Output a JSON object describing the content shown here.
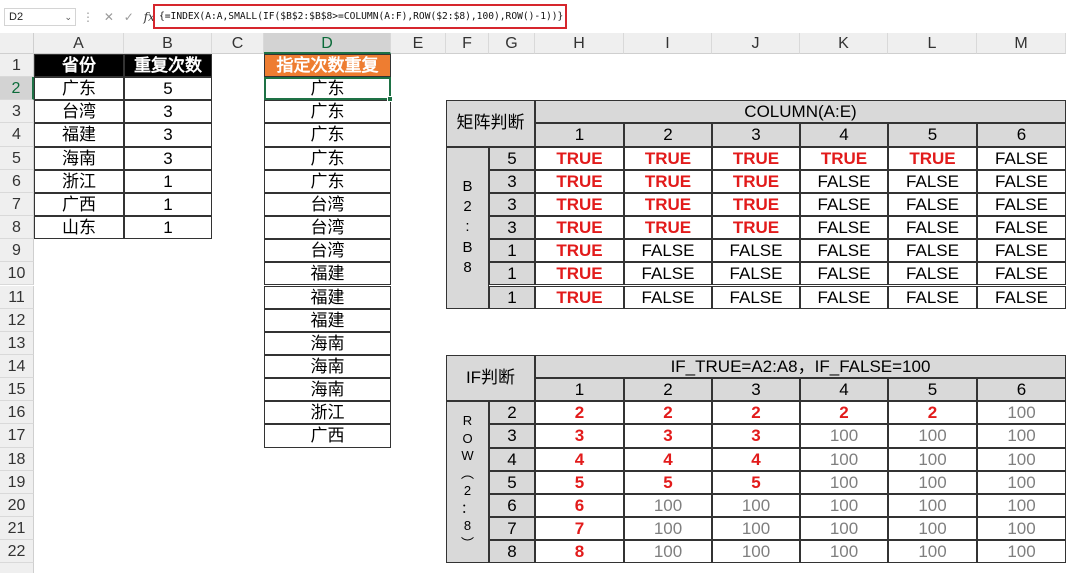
{
  "formula_bar": {
    "name_box": "D2",
    "name_box_dropdown": "⌄",
    "more_icon": "⋮",
    "cancel_icon": "✕",
    "enter_icon": "✓",
    "fx_label": "fx",
    "formula": "{=INDEX(A:A,SMALL(IF($B$2:$B$8>=COLUMN(A:F),ROW($2:$8),100),ROW()-1))}"
  },
  "columns": [
    "A",
    "B",
    "C",
    "D",
    "E",
    "F",
    "G",
    "H",
    "I",
    "J",
    "K",
    "L",
    "M"
  ],
  "rows": [
    "1",
    "2",
    "3",
    "4",
    "5",
    "6",
    "7",
    "8",
    "9",
    "10",
    "11",
    "12",
    "13",
    "14",
    "15",
    "16",
    "17",
    "18",
    "19",
    "20",
    "21",
    "22"
  ],
  "source_table": {
    "headers": [
      "省份",
      "重复次数"
    ],
    "rows": [
      [
        "广东",
        "5"
      ],
      [
        "台湾",
        "3"
      ],
      [
        "福建",
        "3"
      ],
      [
        "海南",
        "3"
      ],
      [
        "浙江",
        "1"
      ],
      [
        "广西",
        "1"
      ],
      [
        "山东",
        "1"
      ]
    ]
  },
  "result_table": {
    "header": "指定次数重复",
    "values": [
      "广东",
      "广东",
      "广东",
      "广东",
      "广东",
      "台湾",
      "台湾",
      "台湾",
      "福建",
      "福建",
      "福建",
      "海南",
      "海南",
      "海南",
      "浙江",
      "广西"
    ]
  },
  "matrix_table": {
    "corner_label": "矩阵判断",
    "title": "COLUMN(A:E)",
    "col_numbers": [
      "1",
      "2",
      "3",
      "4",
      "5",
      "6"
    ],
    "side_label": [
      "B",
      "2",
      ":",
      "B",
      "8"
    ],
    "row_values": [
      "5",
      "3",
      "3",
      "3",
      "1",
      "1",
      "1"
    ],
    "cells": [
      [
        "TRUE",
        "TRUE",
        "TRUE",
        "TRUE",
        "TRUE",
        "FALSE"
      ],
      [
        "TRUE",
        "TRUE",
        "TRUE",
        "FALSE",
        "FALSE",
        "FALSE"
      ],
      [
        "TRUE",
        "TRUE",
        "TRUE",
        "FALSE",
        "FALSE",
        "FALSE"
      ],
      [
        "TRUE",
        "TRUE",
        "TRUE",
        "FALSE",
        "FALSE",
        "FALSE"
      ],
      [
        "TRUE",
        "FALSE",
        "FALSE",
        "FALSE",
        "FALSE",
        "FALSE"
      ],
      [
        "TRUE",
        "FALSE",
        "FALSE",
        "FALSE",
        "FALSE",
        "FALSE"
      ],
      [
        "TRUE",
        "FALSE",
        "FALSE",
        "FALSE",
        "FALSE",
        "FALSE"
      ]
    ]
  },
  "if_table": {
    "corner_label": "IF判断",
    "title": "IF_TRUE=A2:A8，IF_FALSE=100",
    "col_numbers": [
      "1",
      "2",
      "3",
      "4",
      "5",
      "6"
    ],
    "side_label": [
      "R",
      "O",
      "W",
      "︵",
      "2",
      "：",
      "8",
      "︶"
    ],
    "row_values": [
      "2",
      "3",
      "4",
      "5",
      "6",
      "7",
      "8"
    ],
    "cells": [
      [
        "2",
        "2",
        "2",
        "2",
        "2",
        "100"
      ],
      [
        "3",
        "3",
        "3",
        "100",
        "100",
        "100"
      ],
      [
        "4",
        "4",
        "4",
        "100",
        "100",
        "100"
      ],
      [
        "5",
        "5",
        "5",
        "100",
        "100",
        "100"
      ],
      [
        "6",
        "100",
        "100",
        "100",
        "100",
        "100"
      ],
      [
        "7",
        "100",
        "100",
        "100",
        "100",
        "100"
      ],
      [
        "8",
        "100",
        "100",
        "100",
        "100",
        "100"
      ]
    ]
  },
  "colors": {
    "accent_red": "#e21b1b",
    "header_black": "#000000",
    "header_orange": "#ee7d31",
    "gray_fill": "#d9d9d9",
    "excel_green": "#1e7145"
  }
}
